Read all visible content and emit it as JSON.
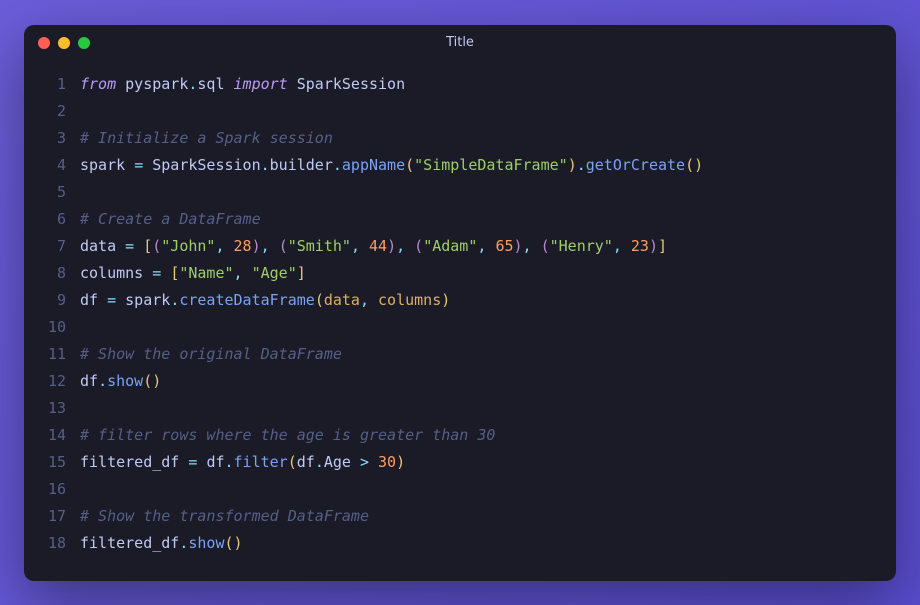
{
  "window": {
    "title": "Title"
  },
  "code": {
    "lines": [
      {
        "n": 1,
        "tokens": [
          {
            "t": "from",
            "c": "tk-keyword"
          },
          {
            "t": " ",
            "c": ""
          },
          {
            "t": "pyspark",
            "c": "tk-module"
          },
          {
            "t": ".",
            "c": "tk-punct"
          },
          {
            "t": "sql",
            "c": "tk-module"
          },
          {
            "t": " ",
            "c": ""
          },
          {
            "t": "import",
            "c": "tk-keyword"
          },
          {
            "t": " ",
            "c": ""
          },
          {
            "t": "SparkSession",
            "c": "tk-class"
          }
        ]
      },
      {
        "n": 2,
        "tokens": []
      },
      {
        "n": 3,
        "tokens": [
          {
            "t": "# Initialize a Spark session",
            "c": "tk-comment"
          }
        ]
      },
      {
        "n": 4,
        "tokens": [
          {
            "t": "spark",
            "c": "tk-var"
          },
          {
            "t": " ",
            "c": ""
          },
          {
            "t": "=",
            "c": "tk-op"
          },
          {
            "t": " ",
            "c": ""
          },
          {
            "t": "SparkSession",
            "c": "tk-class"
          },
          {
            "t": ".",
            "c": "tk-punct"
          },
          {
            "t": "builder",
            "c": "tk-var"
          },
          {
            "t": ".",
            "c": "tk-punct"
          },
          {
            "t": "appName",
            "c": "tk-func"
          },
          {
            "t": "(",
            "c": "tk-bracket1"
          },
          {
            "t": "\"SimpleDataFrame\"",
            "c": "tk-string"
          },
          {
            "t": ")",
            "c": "tk-bracket1"
          },
          {
            "t": ".",
            "c": "tk-punct"
          },
          {
            "t": "getOrCreate",
            "c": "tk-func"
          },
          {
            "t": "(",
            "c": "tk-bracket1"
          },
          {
            "t": ")",
            "c": "tk-bracket1"
          }
        ]
      },
      {
        "n": 5,
        "tokens": []
      },
      {
        "n": 6,
        "tokens": [
          {
            "t": "# Create a DataFrame",
            "c": "tk-comment"
          }
        ]
      },
      {
        "n": 7,
        "tokens": [
          {
            "t": "data",
            "c": "tk-var"
          },
          {
            "t": " ",
            "c": ""
          },
          {
            "t": "=",
            "c": "tk-op"
          },
          {
            "t": " ",
            "c": ""
          },
          {
            "t": "[",
            "c": "tk-bracket1"
          },
          {
            "t": "(",
            "c": "tk-bracket2"
          },
          {
            "t": "\"John\"",
            "c": "tk-string"
          },
          {
            "t": ",",
            "c": "tk-punct"
          },
          {
            "t": " ",
            "c": ""
          },
          {
            "t": "28",
            "c": "tk-number"
          },
          {
            "t": ")",
            "c": "tk-bracket2"
          },
          {
            "t": ",",
            "c": "tk-punct"
          },
          {
            "t": " ",
            "c": ""
          },
          {
            "t": "(",
            "c": "tk-bracket2"
          },
          {
            "t": "\"Smith\"",
            "c": "tk-string"
          },
          {
            "t": ",",
            "c": "tk-punct"
          },
          {
            "t": " ",
            "c": ""
          },
          {
            "t": "44",
            "c": "tk-number"
          },
          {
            "t": ")",
            "c": "tk-bracket2"
          },
          {
            "t": ",",
            "c": "tk-punct"
          },
          {
            "t": " ",
            "c": ""
          },
          {
            "t": "(",
            "c": "tk-bracket2"
          },
          {
            "t": "\"Adam\"",
            "c": "tk-string"
          },
          {
            "t": ",",
            "c": "tk-punct"
          },
          {
            "t": " ",
            "c": ""
          },
          {
            "t": "65",
            "c": "tk-number"
          },
          {
            "t": ")",
            "c": "tk-bracket2"
          },
          {
            "t": ",",
            "c": "tk-punct"
          },
          {
            "t": " ",
            "c": ""
          },
          {
            "t": "(",
            "c": "tk-bracket2"
          },
          {
            "t": "\"Henry\"",
            "c": "tk-string"
          },
          {
            "t": ",",
            "c": "tk-punct"
          },
          {
            "t": " ",
            "c": ""
          },
          {
            "t": "23",
            "c": "tk-number"
          },
          {
            "t": ")",
            "c": "tk-bracket2"
          },
          {
            "t": "]",
            "c": "tk-bracket1"
          }
        ]
      },
      {
        "n": 8,
        "tokens": [
          {
            "t": "columns",
            "c": "tk-var"
          },
          {
            "t": " ",
            "c": ""
          },
          {
            "t": "=",
            "c": "tk-op"
          },
          {
            "t": " ",
            "c": ""
          },
          {
            "t": "[",
            "c": "tk-bracket1"
          },
          {
            "t": "\"Name\"",
            "c": "tk-string"
          },
          {
            "t": ",",
            "c": "tk-punct"
          },
          {
            "t": " ",
            "c": ""
          },
          {
            "t": "\"Age\"",
            "c": "tk-string"
          },
          {
            "t": "]",
            "c": "tk-bracket1"
          }
        ]
      },
      {
        "n": 9,
        "tokens": [
          {
            "t": "df",
            "c": "tk-var"
          },
          {
            "t": " ",
            "c": ""
          },
          {
            "t": "=",
            "c": "tk-op"
          },
          {
            "t": " ",
            "c": ""
          },
          {
            "t": "spark",
            "c": "tk-var"
          },
          {
            "t": ".",
            "c": "tk-punct"
          },
          {
            "t": "createDataFrame",
            "c": "tk-func"
          },
          {
            "t": "(",
            "c": "tk-bracket1"
          },
          {
            "t": "data",
            "c": "tk-param"
          },
          {
            "t": ",",
            "c": "tk-punct"
          },
          {
            "t": " ",
            "c": ""
          },
          {
            "t": "columns",
            "c": "tk-param"
          },
          {
            "t": ")",
            "c": "tk-bracket1"
          }
        ]
      },
      {
        "n": 10,
        "tokens": []
      },
      {
        "n": 11,
        "tokens": [
          {
            "t": "# Show the original DataFrame",
            "c": "tk-comment"
          }
        ]
      },
      {
        "n": 12,
        "tokens": [
          {
            "t": "df",
            "c": "tk-var"
          },
          {
            "t": ".",
            "c": "tk-punct"
          },
          {
            "t": "show",
            "c": "tk-func"
          },
          {
            "t": "(",
            "c": "tk-bracket1"
          },
          {
            "t": ")",
            "c": "tk-bracket1"
          }
        ]
      },
      {
        "n": 13,
        "tokens": []
      },
      {
        "n": 14,
        "tokens": [
          {
            "t": "# filter rows where the age is greater than 30",
            "c": "tk-comment"
          }
        ]
      },
      {
        "n": 15,
        "tokens": [
          {
            "t": "filtered_df",
            "c": "tk-var"
          },
          {
            "t": " ",
            "c": ""
          },
          {
            "t": "=",
            "c": "tk-op"
          },
          {
            "t": " ",
            "c": ""
          },
          {
            "t": "df",
            "c": "tk-var"
          },
          {
            "t": ".",
            "c": "tk-punct"
          },
          {
            "t": "filter",
            "c": "tk-func"
          },
          {
            "t": "(",
            "c": "tk-bracket1"
          },
          {
            "t": "df",
            "c": "tk-var"
          },
          {
            "t": ".",
            "c": "tk-punct"
          },
          {
            "t": "Age",
            "c": "tk-var"
          },
          {
            "t": " ",
            "c": ""
          },
          {
            "t": ">",
            "c": "tk-op"
          },
          {
            "t": " ",
            "c": ""
          },
          {
            "t": "30",
            "c": "tk-number"
          },
          {
            "t": ")",
            "c": "tk-bracket1"
          }
        ]
      },
      {
        "n": 16,
        "tokens": []
      },
      {
        "n": 17,
        "tokens": [
          {
            "t": "# Show the transformed DataFrame",
            "c": "tk-comment"
          }
        ]
      },
      {
        "n": 18,
        "tokens": [
          {
            "t": "filtered_df",
            "c": "tk-var"
          },
          {
            "t": ".",
            "c": "tk-punct"
          },
          {
            "t": "show",
            "c": "tk-func"
          },
          {
            "t": "(",
            "c": "tk-bracket1"
          },
          {
            "t": ")",
            "c": "tk-bracket1"
          }
        ]
      }
    ]
  }
}
